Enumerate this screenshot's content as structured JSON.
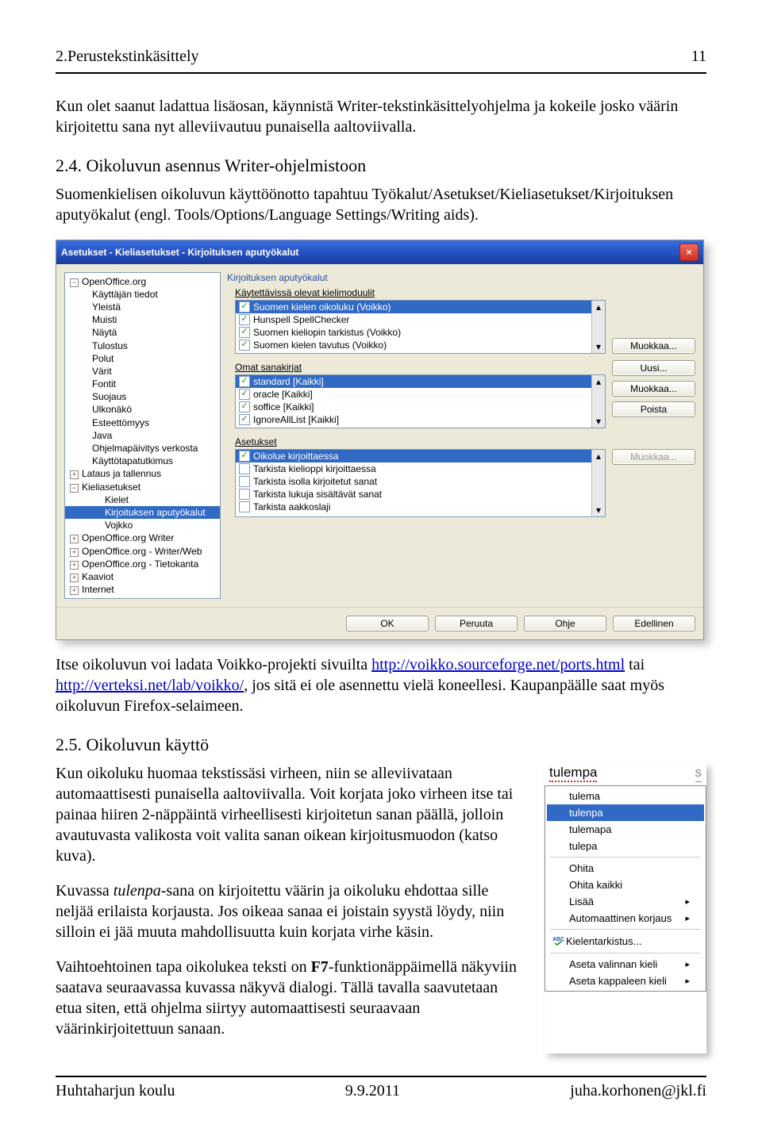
{
  "header": {
    "left": "2.Perustekstinkäsittely",
    "right": "11"
  },
  "intro": "Kun olet saanut ladattua lisäosan, käynnistä Writer-tekstinkäsittelyohjelma ja kokeile josko väärin kirjoitettu sana nyt alleviivautuu punaisella aaltoviivalla.",
  "section24": {
    "number": " 2.4. ",
    "title": "Oikoluvun asennus Writer-ohjelmistoon",
    "body": "Suomenkielisen oikoluvun käyttöönotto tapahtuu Työkalut/Asetukset/Kieliasetukset/Kirjoituksen aputyökalut (engl. Tools/Options/Language Settings/Writing aids)."
  },
  "dialog1": {
    "title": "Asetukset - Kieliasetukset - Kirjoituksen aputyökalut",
    "tree": {
      "top": "OpenOffice.org",
      "items": [
        "Käyttäjän tiedot",
        "Yleistä",
        "Muisti",
        "Näytä",
        "Tulostus",
        "Polut",
        "Värit",
        "Fontit",
        "Suojaus",
        "Ulkonäkö",
        "Esteettömyys",
        "Java",
        "Ohjelmapäivitys verkosta",
        "Käyttötapatutkimus"
      ],
      "groups": [
        "Lataus ja tallennus",
        "Kieliasetukset"
      ],
      "lang_items": [
        "Kielet",
        "Kirjoituksen aputyökalut",
        "Vojkko"
      ],
      "bottom": [
        "OpenOffice.org Writer",
        "OpenOffice.org - Writer/Web",
        "OpenOffice.org - Tietokanta",
        "Kaaviot",
        "Internet"
      ]
    },
    "group_label": "Kirjoituksen aputyökalut",
    "modules_label": "Käytettävissä olevat kielimoduulit",
    "modules": [
      "Suomen kielen oikoluku (Voikko)",
      "Hunspell SpellChecker",
      "Suomen kieliopin tarkistus (Voikko)",
      "Suomen kielen tavutus (Voikko)"
    ],
    "dicts_label": "Omat sanakirjat",
    "dicts": [
      "standard [Kaikki]",
      "oracle [Kaikki]",
      "soffice [Kaikki]",
      "IgnoreAllList [Kaikki]"
    ],
    "opts_label": "Asetukset",
    "opts": [
      "Oikolue kirjoittaessa",
      "Tarkista kielioppi kirjoittaessa",
      "Tarkista isolla kirjoitetut sanat",
      "Tarkista lukuja sisältävät sanat",
      "Tarkista aakkoslaji"
    ],
    "btn_modify": "Muokkaa...",
    "btn_new": "Uusi...",
    "btn_modify2": "Muokkaa...",
    "btn_delete": "Poista",
    "btn_modify3": "Muokkaa...",
    "btn_ok": "OK",
    "btn_cancel": "Peruuta",
    "btn_help": "Ohje",
    "btn_prev": "Edellinen"
  },
  "after_shot1_a": " Itse oikoluvun voi ladata Voikko-projekti sivuilta ",
  "link1": "http://voikko.sourceforge.net/ports.html",
  "after_shot1_b": " tai ",
  "link2": "http://verteksi.net/lab/voikko/",
  "after_shot1_c": ", jos sitä ei ole asennettu vielä koneellesi. Kaupanpäälle saat myös oikoluvun Firefox-selaimeen.",
  "section25": {
    "number": " 2.5. ",
    "title": "Oikoluvun käyttö",
    "p1": "Kun oikoluku huomaa tekstissäsi virheen, niin se alleviivataan automaattisesti punaisella aaltoviivalla. Voit korjata joko virheen itse tai painaa hiiren 2-näppäintä virheellisesti kirjoitetun sanan päällä, jolloin avautuvasta valikosta voit valita sanan oikean kirjoitusmuodon (katso kuva).",
    "p2_a": "Kuvassa ",
    "p2_i": "tulenpa",
    "p2_b": "-sana on kirjoitettu väärin ja oikoluku ehdottaa sille neljää erilaista korjausta. Jos oikeaa sanaa ei joistain syystä löydy, niin silloin ei jää muuta mahdollisuutta kuin korjata virhe käsin.",
    "p3_a": "Vaihtoehtoinen tapa oikolukea teksti on ",
    "p3_key": "F7",
    "p3_b": "-funktionäppäimellä näkyviin saatava seuraavassa kuvassa näkyvä dialogi. Tällä tavalla saavutetaan etua siten, että ohjelma siirtyy automaattisesti seuraavaan väärinkirjoitettuun sanaan."
  },
  "menu2": {
    "word": "tulempa",
    "right_s": "s",
    "suggest": [
      "tulema",
      "tulenpa",
      "tulemapa",
      "tulepa"
    ],
    "ignore": "Ohita",
    "ignore_all": "Ohita kaikki",
    "add": "Lisää",
    "autocorrect": "Automaattinen korjaus",
    "spellcheck": "Kielentarkistus...",
    "set_sel_lang": "Aseta valinnan kieli",
    "set_para_lang": "Aseta kappaleen kieli"
  },
  "footer": {
    "left": "Huhtaharjun koulu",
    "center": "9.9.2011",
    "right": "juha.korhonen@jkl.fi"
  }
}
